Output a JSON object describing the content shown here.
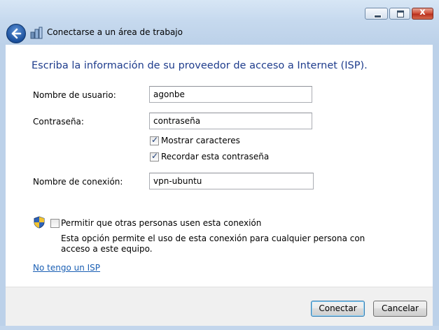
{
  "window": {
    "title": "Conectarse a un área de trabajo",
    "caption_buttons": [
      "minimize",
      "maximize",
      "close"
    ],
    "close_glyph": "x"
  },
  "header": {
    "back_icon": "back-arrow-icon",
    "app_icon": "network-connection-icon"
  },
  "form": {
    "heading": "Escriba la información de su proveedor de acceso a Internet (ISP).",
    "username_label": "Nombre de usuario:",
    "username_value": "agonbe",
    "password_label": "Contraseña:",
    "password_value": "contraseña",
    "show_chars_label": "Mostrar caracteres",
    "show_chars_checked": true,
    "remember_label": "Recordar esta contraseña",
    "remember_checked": true,
    "connection_name_label": "Nombre de conexión:",
    "connection_name_value": "vpn-ubuntu",
    "allow_others_label": "Permitir que otras personas usen esta conexión",
    "allow_others_checked": false,
    "allow_others_desc": "Esta opción permite el uso de esta conexión para cualquier persona con acceso a este equipo.",
    "no_isp_link": "No tengo un ISP"
  },
  "footer": {
    "connect_label": "Conectar",
    "cancel_label": "Cancelar"
  },
  "colors": {
    "heading": "#1e3c8c",
    "link": "#1a5fb4",
    "frame": "#c6d9ee"
  }
}
